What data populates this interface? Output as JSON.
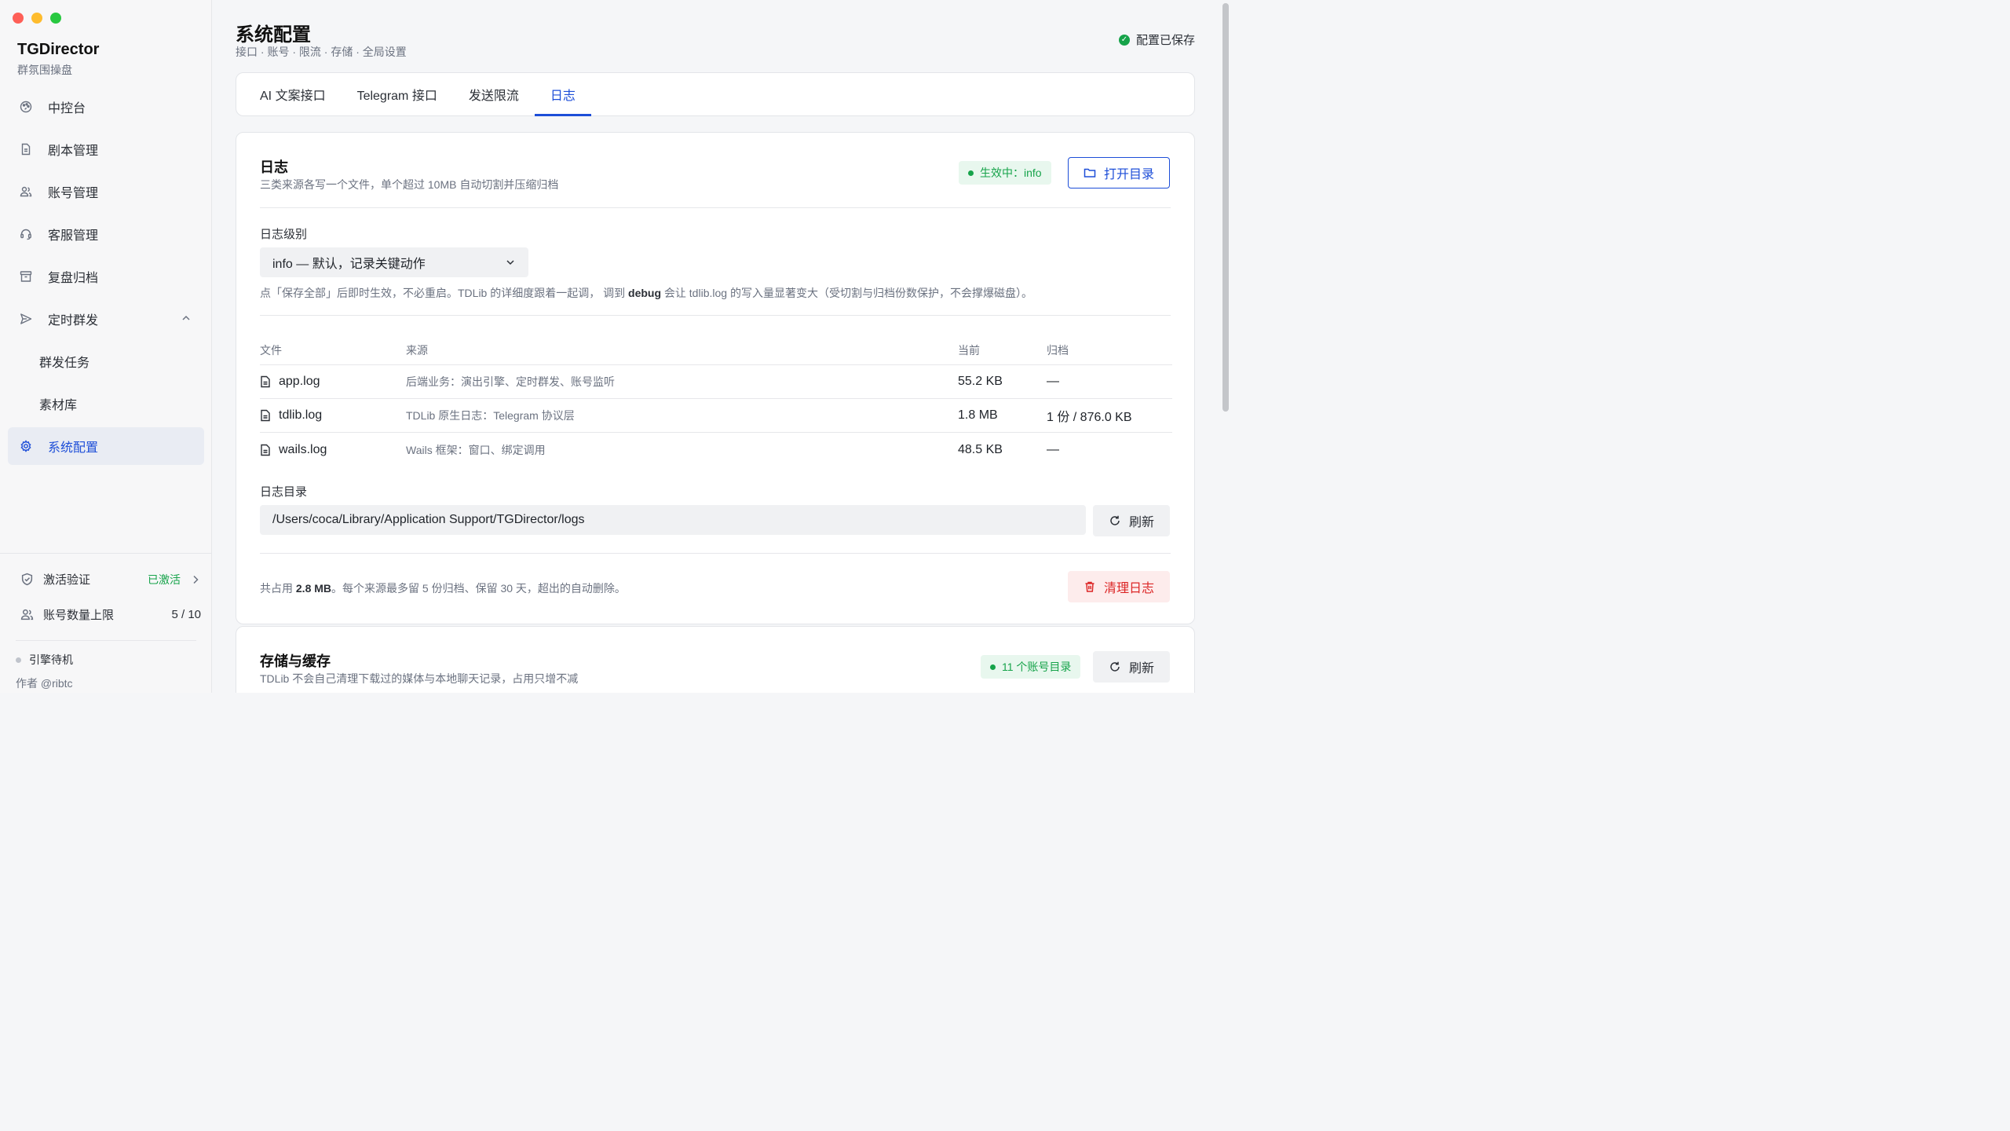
{
  "sidebar": {
    "brand_title": "TGDirector",
    "brand_subtitle": "群氛围操盘",
    "items": [
      {
        "label": "中控台",
        "icon": "palette-icon"
      },
      {
        "label": "剧本管理",
        "icon": "document-icon"
      },
      {
        "label": "账号管理",
        "icon": "users-icon"
      },
      {
        "label": "客服管理",
        "icon": "headset-icon"
      },
      {
        "label": "复盘归档",
        "icon": "archive-icon"
      },
      {
        "label": "定时群发",
        "icon": "send-icon",
        "expanded": true
      },
      {
        "label": "群发任务"
      },
      {
        "label": "素材库"
      },
      {
        "label": "系统配置",
        "icon": "gear-icon",
        "active": true
      }
    ],
    "activation_label": "激活验证",
    "activation_status": "已激活",
    "account_limit_label": "账号数量上限",
    "account_limit_value": "5 / 10",
    "engine_status": "引擎待机",
    "author": "作者 @ribtc"
  },
  "header": {
    "title": "系统配置",
    "subtitle": "接口 · 账号 · 限流 · 存储 · 全局设置",
    "saved_status": "配置已保存"
  },
  "tabs": [
    {
      "label": "AI 文案接口",
      "active": false
    },
    {
      "label": "Telegram 接口",
      "active": false
    },
    {
      "label": "发送限流",
      "active": false
    },
    {
      "label": "日志",
      "active": true
    }
  ],
  "log_section": {
    "title": "日志",
    "subtitle": "三类来源各写一个文件，单个超过 10MB 自动切割并压缩归档",
    "active_badge": "生效中：info",
    "open_dir_label": "打开目录",
    "level_label": "日志级别",
    "level_value": "info — 默认，记录关键动作",
    "hint_prefix": "点「保存全部」后即时生效，不必重启。TDLib 的详细度跟着一起调， 调到 ",
    "hint_bold": "debug",
    "hint_suffix": " 会让 tdlib.log 的写入量显著变大（受切割与归档份数保护，不会撑爆磁盘）。",
    "table": {
      "headers": [
        "文件",
        "来源",
        "当前",
        "归档"
      ],
      "rows": [
        {
          "file": "app.log",
          "source": "后端业务：演出引擎、定时群发、账号监听",
          "current": "55.2 KB",
          "archive": "—"
        },
        {
          "file": "tdlib.log",
          "source": "TDLib 原生日志：Telegram 协议层",
          "current": "1.8 MB",
          "archive": "1 份 / 876.0 KB"
        },
        {
          "file": "wails.log",
          "source": "Wails 框架：窗口、绑定调用",
          "current": "48.5 KB",
          "archive": "—"
        }
      ]
    },
    "dir_label": "日志目录",
    "dir_path": "/Users/coca/Library/Application Support/TGDirector/logs",
    "refresh_label": "刷新",
    "usage_prefix": "共占用 ",
    "usage_bold": "2.8 MB",
    "usage_suffix": "。每个来源最多留 5 份归档、保留 30 天，超出的自动删除。",
    "clear_label": "清理日志"
  },
  "storage_section": {
    "title": "存储与缓存",
    "subtitle": "TDLib 不会自己清理下载过的媒体与本地聊天记录，占用只增不减",
    "badge": "11 个账号目录",
    "refresh_label": "刷新"
  },
  "colors": {
    "accent": "#1d4ed8",
    "success": "#16a34a",
    "danger": "#dc2626"
  }
}
